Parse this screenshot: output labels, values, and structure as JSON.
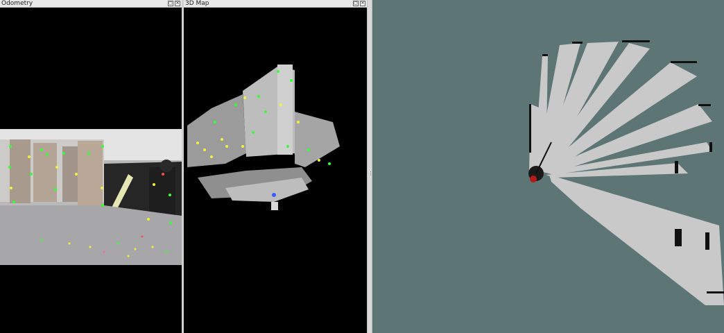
{
  "panels": {
    "odometry": {
      "title": "Odometry"
    },
    "map3d": {
      "title": "3D Map"
    }
  },
  "window_buttons": {
    "float": "▢",
    "close": "✕"
  },
  "icons": {
    "float": "float-window-icon",
    "close": "close-window-icon",
    "splitter": "splitter-handle-icon"
  },
  "splitter": {
    "glyph": "⋮"
  },
  "colors": {
    "panel_background": "#000000",
    "gridmap_background": "#5d7675",
    "free_space": "#c9c9c9",
    "obstacle": "#111111",
    "robot": "#b31a1a",
    "feature_green": "#33ff33",
    "feature_yellow": "#f2f23a"
  }
}
